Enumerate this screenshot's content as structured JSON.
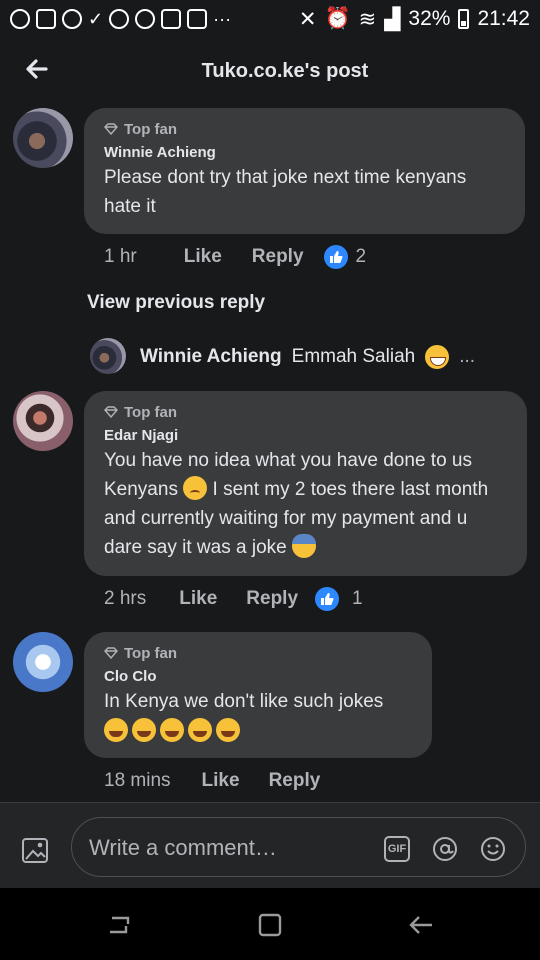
{
  "status_bar": {
    "left_icons": [
      "chrome-icon",
      "tiktok-icon",
      "facebook-icon",
      "check-download-icon",
      "chrome-icon",
      "chrome-icon",
      "gmail-icon",
      "gmail-icon",
      "more-dots-icon"
    ],
    "more_dots": "···",
    "battery_pct": "32%",
    "time": "21:42"
  },
  "header": {
    "title": "Tuko.co.ke's post"
  },
  "comments": [
    {
      "badge": "Top fan",
      "author": "Winnie Achieng",
      "text": "Please dont try that joke next time kenyans hate it",
      "time": "1 hr",
      "like_label": "Like",
      "reply_label": "Reply",
      "reactions": "2"
    },
    {
      "badge": "Top fan",
      "author": "Edar Njagi",
      "text_a": "You have no idea what you have done to us Kenyans",
      "text_b": "I sent my 2 toes there last month and currently waiting for my payment and u dare say it was a joke",
      "time": "2 hrs",
      "like_label": "Like",
      "reply_label": "Reply",
      "reactions": "1"
    },
    {
      "badge": "Top fan",
      "author": "Clo Clo",
      "text": "In Kenya we don't like such jokes",
      "emoji_names": [
        "face-with-tears-of-joy",
        "face-with-tears-of-joy",
        "face-with-tears-of-joy",
        "face-with-tears-of-joy",
        "face-with-tears-of-joy"
      ],
      "time": "18 mins",
      "like_label": "Like",
      "reply_label": "Reply"
    }
  ],
  "view_previous": "View previous reply",
  "reply_preview": {
    "author": "Winnie Achieng",
    "text": "Emmah Saliah",
    "ellipsis": "..."
  },
  "composer": {
    "placeholder": "Write a comment…",
    "gif_label": "GIF"
  },
  "colors": {
    "background": "#18191a",
    "bubble": "#3a3b3c",
    "like_blue": "#2d88ff",
    "text_primary": "#e4e6eb",
    "text_secondary": "#b0b3b8"
  }
}
